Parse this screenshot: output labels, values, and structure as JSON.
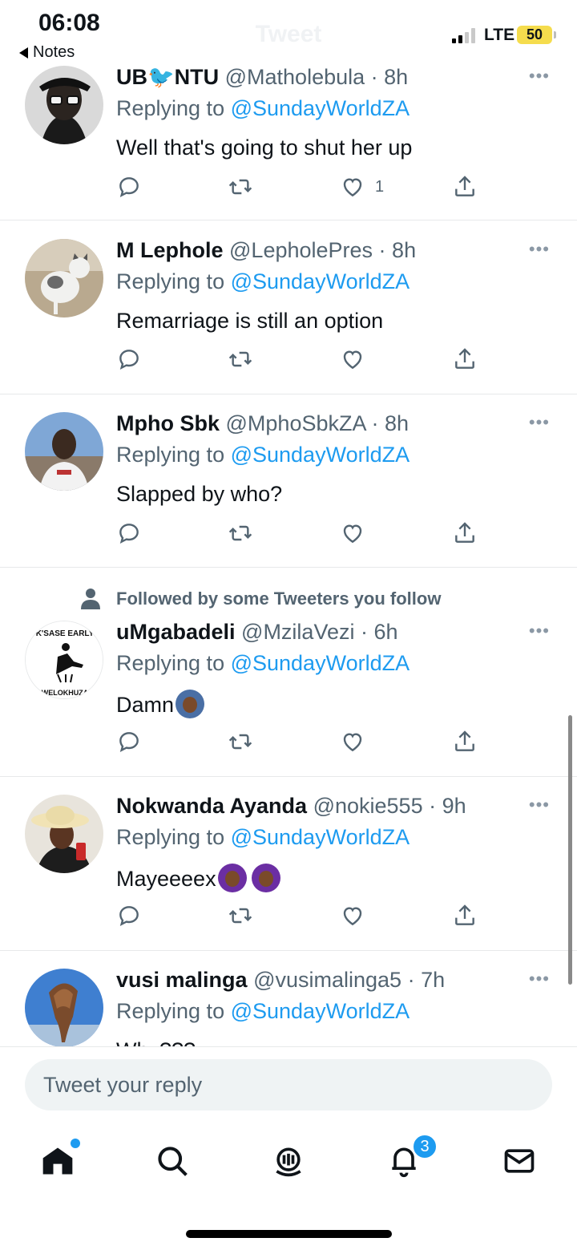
{
  "status_bar": {
    "time": "06:08",
    "back_app": "Notes",
    "network": "LTE",
    "battery": "50",
    "title": "Tweet"
  },
  "colors": {
    "accent": "#1d9bf0",
    "muted": "#536471",
    "text": "#0f1419",
    "battery": "#f5dc4d"
  },
  "tweets": [
    {
      "name": "UB🐦NTU",
      "handle": "@Matholebula",
      "time": "8h",
      "replying_label": "Replying to ",
      "replying_to": "@SundayWorldZA",
      "text": "Well that's going to shut her up",
      "like_count": "1",
      "avatar_icon": "person-sunglasses-avatar"
    },
    {
      "name": "M Lephole",
      "handle": "@LepholePres",
      "time": "8h",
      "replying_label": "Replying to ",
      "replying_to": "@SundayWorldZA",
      "text": "Remarriage is still an option",
      "avatar_icon": "cat-avatar"
    },
    {
      "name": "Mpho Sbk",
      "handle": "@MphoSbkZA",
      "time": "8h",
      "replying_label": "Replying to ",
      "replying_to": "@SundayWorldZA",
      "text": "Slapped by who?",
      "avatar_icon": "person-avatar"
    },
    {
      "social_context": "Followed by some Tweeters you follow",
      "name": "uMgabadeli",
      "handle": "@MzilaVezi",
      "time": "6h",
      "replying_label": "Replying to ",
      "replying_to": "@SundayWorldZA",
      "text": "Damn",
      "avatar_top_text": "K'SASE EARLY",
      "avatar_bottom_text": "WELOKHUZA",
      "emoji": "woman-gesturing-ok"
    },
    {
      "name": "Nokwanda Ayanda",
      "handle": "@nokie555",
      "time": "9h",
      "replying_label": "Replying to ",
      "replying_to": "@SundayWorldZA",
      "text": "Mayeeeex",
      "emoji": "woman-gesturing-ok",
      "avatar_icon": "woman-hat-avatar"
    },
    {
      "name": "vusi malinga",
      "handle": "@vusimalinga5",
      "time": "7h",
      "replying_label": "Replying to ",
      "replying_to": "@SundayWorldZA",
      "text": "Why???",
      "avatar_icon": "rock-formation-avatar"
    }
  ],
  "reply_box": {
    "placeholder": "Tweet your reply"
  },
  "tab_bar": {
    "items": [
      "home-icon",
      "search-icon",
      "spaces-icon",
      "notifications-icon",
      "messages-icon"
    ],
    "notifications_badge": "3"
  }
}
